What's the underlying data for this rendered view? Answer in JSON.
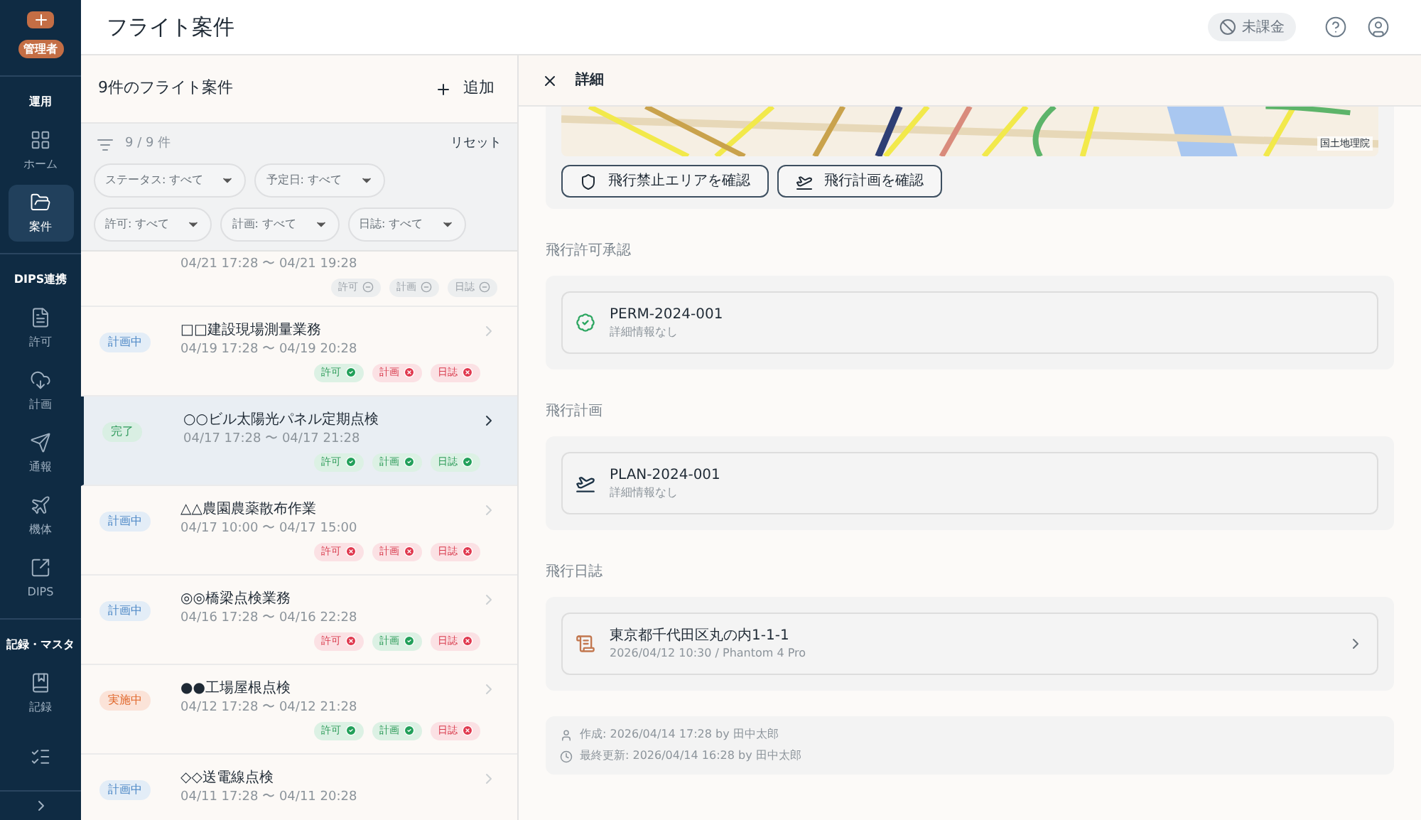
{
  "sidebar": {
    "role_badge": "管理者",
    "sections": [
      {
        "heading": "運用",
        "items": [
          {
            "label": "ホーム",
            "selected": false
          },
          {
            "label": "案件",
            "selected": true
          }
        ]
      },
      {
        "heading": "DIPS連携",
        "items": [
          {
            "label": "許可",
            "selected": false
          },
          {
            "label": "計画",
            "selected": false
          },
          {
            "label": "通報",
            "selected": false
          },
          {
            "label": "機体",
            "selected": false
          },
          {
            "label": "DIPS",
            "selected": false
          }
        ]
      },
      {
        "heading": "記録・マスタ",
        "items": [
          {
            "label": "記録",
            "selected": false
          },
          {
            "selected": false
          }
        ]
      }
    ]
  },
  "header": {
    "title": "フライト案件",
    "billing_badge": "未課金"
  },
  "list": {
    "title": "9件のフライト案件",
    "add_button": "追加",
    "filter_count": "9 / 9 件",
    "reset": "リセット",
    "filters": [
      "ステータス: すべて",
      "予定日: すべて",
      "許可: すべて",
      "計画: すべて",
      "日誌: すべて"
    ],
    "items": [
      {
        "time": "04/21 17:28 〜 04/21 19:28",
        "selected": false,
        "tags": [
          {
            "label": "許可",
            "kind": "none"
          },
          {
            "label": "計画",
            "kind": "none"
          },
          {
            "label": "日誌",
            "kind": "none"
          }
        ]
      },
      {
        "status": "計画中",
        "kind": "planned",
        "title": "□□建設現場測量業務",
        "time": "04/19 17:28 〜 04/19 20:28",
        "selected": false,
        "tags": [
          {
            "label": "許可",
            "kind": "ok"
          },
          {
            "label": "計画",
            "kind": "ng"
          },
          {
            "label": "日誌",
            "kind": "ng"
          }
        ]
      },
      {
        "status": "完了",
        "kind": "done",
        "title": "○○ビル太陽光パネル定期点検",
        "time": "04/17 17:28 〜 04/17 21:28",
        "selected": true,
        "tags": [
          {
            "label": "許可",
            "kind": "ok"
          },
          {
            "label": "計画",
            "kind": "ok"
          },
          {
            "label": "日誌",
            "kind": "ok"
          }
        ]
      },
      {
        "status": "計画中",
        "kind": "planned",
        "title": "△△農園農薬散布作業",
        "time": "04/17 10:00 〜 04/17 15:00",
        "selected": false,
        "tags": [
          {
            "label": "許可",
            "kind": "ng"
          },
          {
            "label": "計画",
            "kind": "ng"
          },
          {
            "label": "日誌",
            "kind": "ng"
          }
        ]
      },
      {
        "status": "計画中",
        "kind": "planned",
        "title": "◎◎橋梁点検業務",
        "time": "04/16 17:28 〜 04/16 22:28",
        "selected": false,
        "tags": [
          {
            "label": "許可",
            "kind": "ng"
          },
          {
            "label": "計画",
            "kind": "ok"
          },
          {
            "label": "日誌",
            "kind": "ng"
          }
        ]
      },
      {
        "status": "実施中",
        "kind": "active",
        "title": "●●工場屋根点検",
        "time": "04/12 17:28 〜 04/12 21:28",
        "selected": false,
        "tags": [
          {
            "label": "許可",
            "kind": "ok"
          },
          {
            "label": "計画",
            "kind": "ok"
          },
          {
            "label": "日誌",
            "kind": "ng"
          }
        ]
      },
      {
        "status": "計画中",
        "kind": "planned",
        "title": "◇◇送電線点検",
        "time": "04/11 17:28 〜 04/11 20:28",
        "selected": false
      }
    ]
  },
  "detail": {
    "title": "詳細",
    "map_attribution": "国土地理院",
    "map_buttons": [
      "飛行禁止エリアを確認",
      "飛行計画を確認"
    ],
    "sections": [
      {
        "heading": "飛行許可承認",
        "kind": "permit",
        "title": "PERM-2024-001",
        "subtitle": "詳細情報なし"
      },
      {
        "heading": "飛行計画",
        "kind": "plan",
        "title": "PLAN-2024-001",
        "subtitle": "詳細情報なし"
      },
      {
        "heading": "飛行日誌",
        "kind": "log",
        "title": "東京都千代田区丸の内1-1-1",
        "subtitle": "2026/04/12 10:30 / Phantom 4 Pro"
      }
    ],
    "meta": [
      "作成: 2026/04/14 17:28 by 田中太郎",
      "最終更新: 2026/04/14 16:28 by 田中太郎"
    ]
  }
}
